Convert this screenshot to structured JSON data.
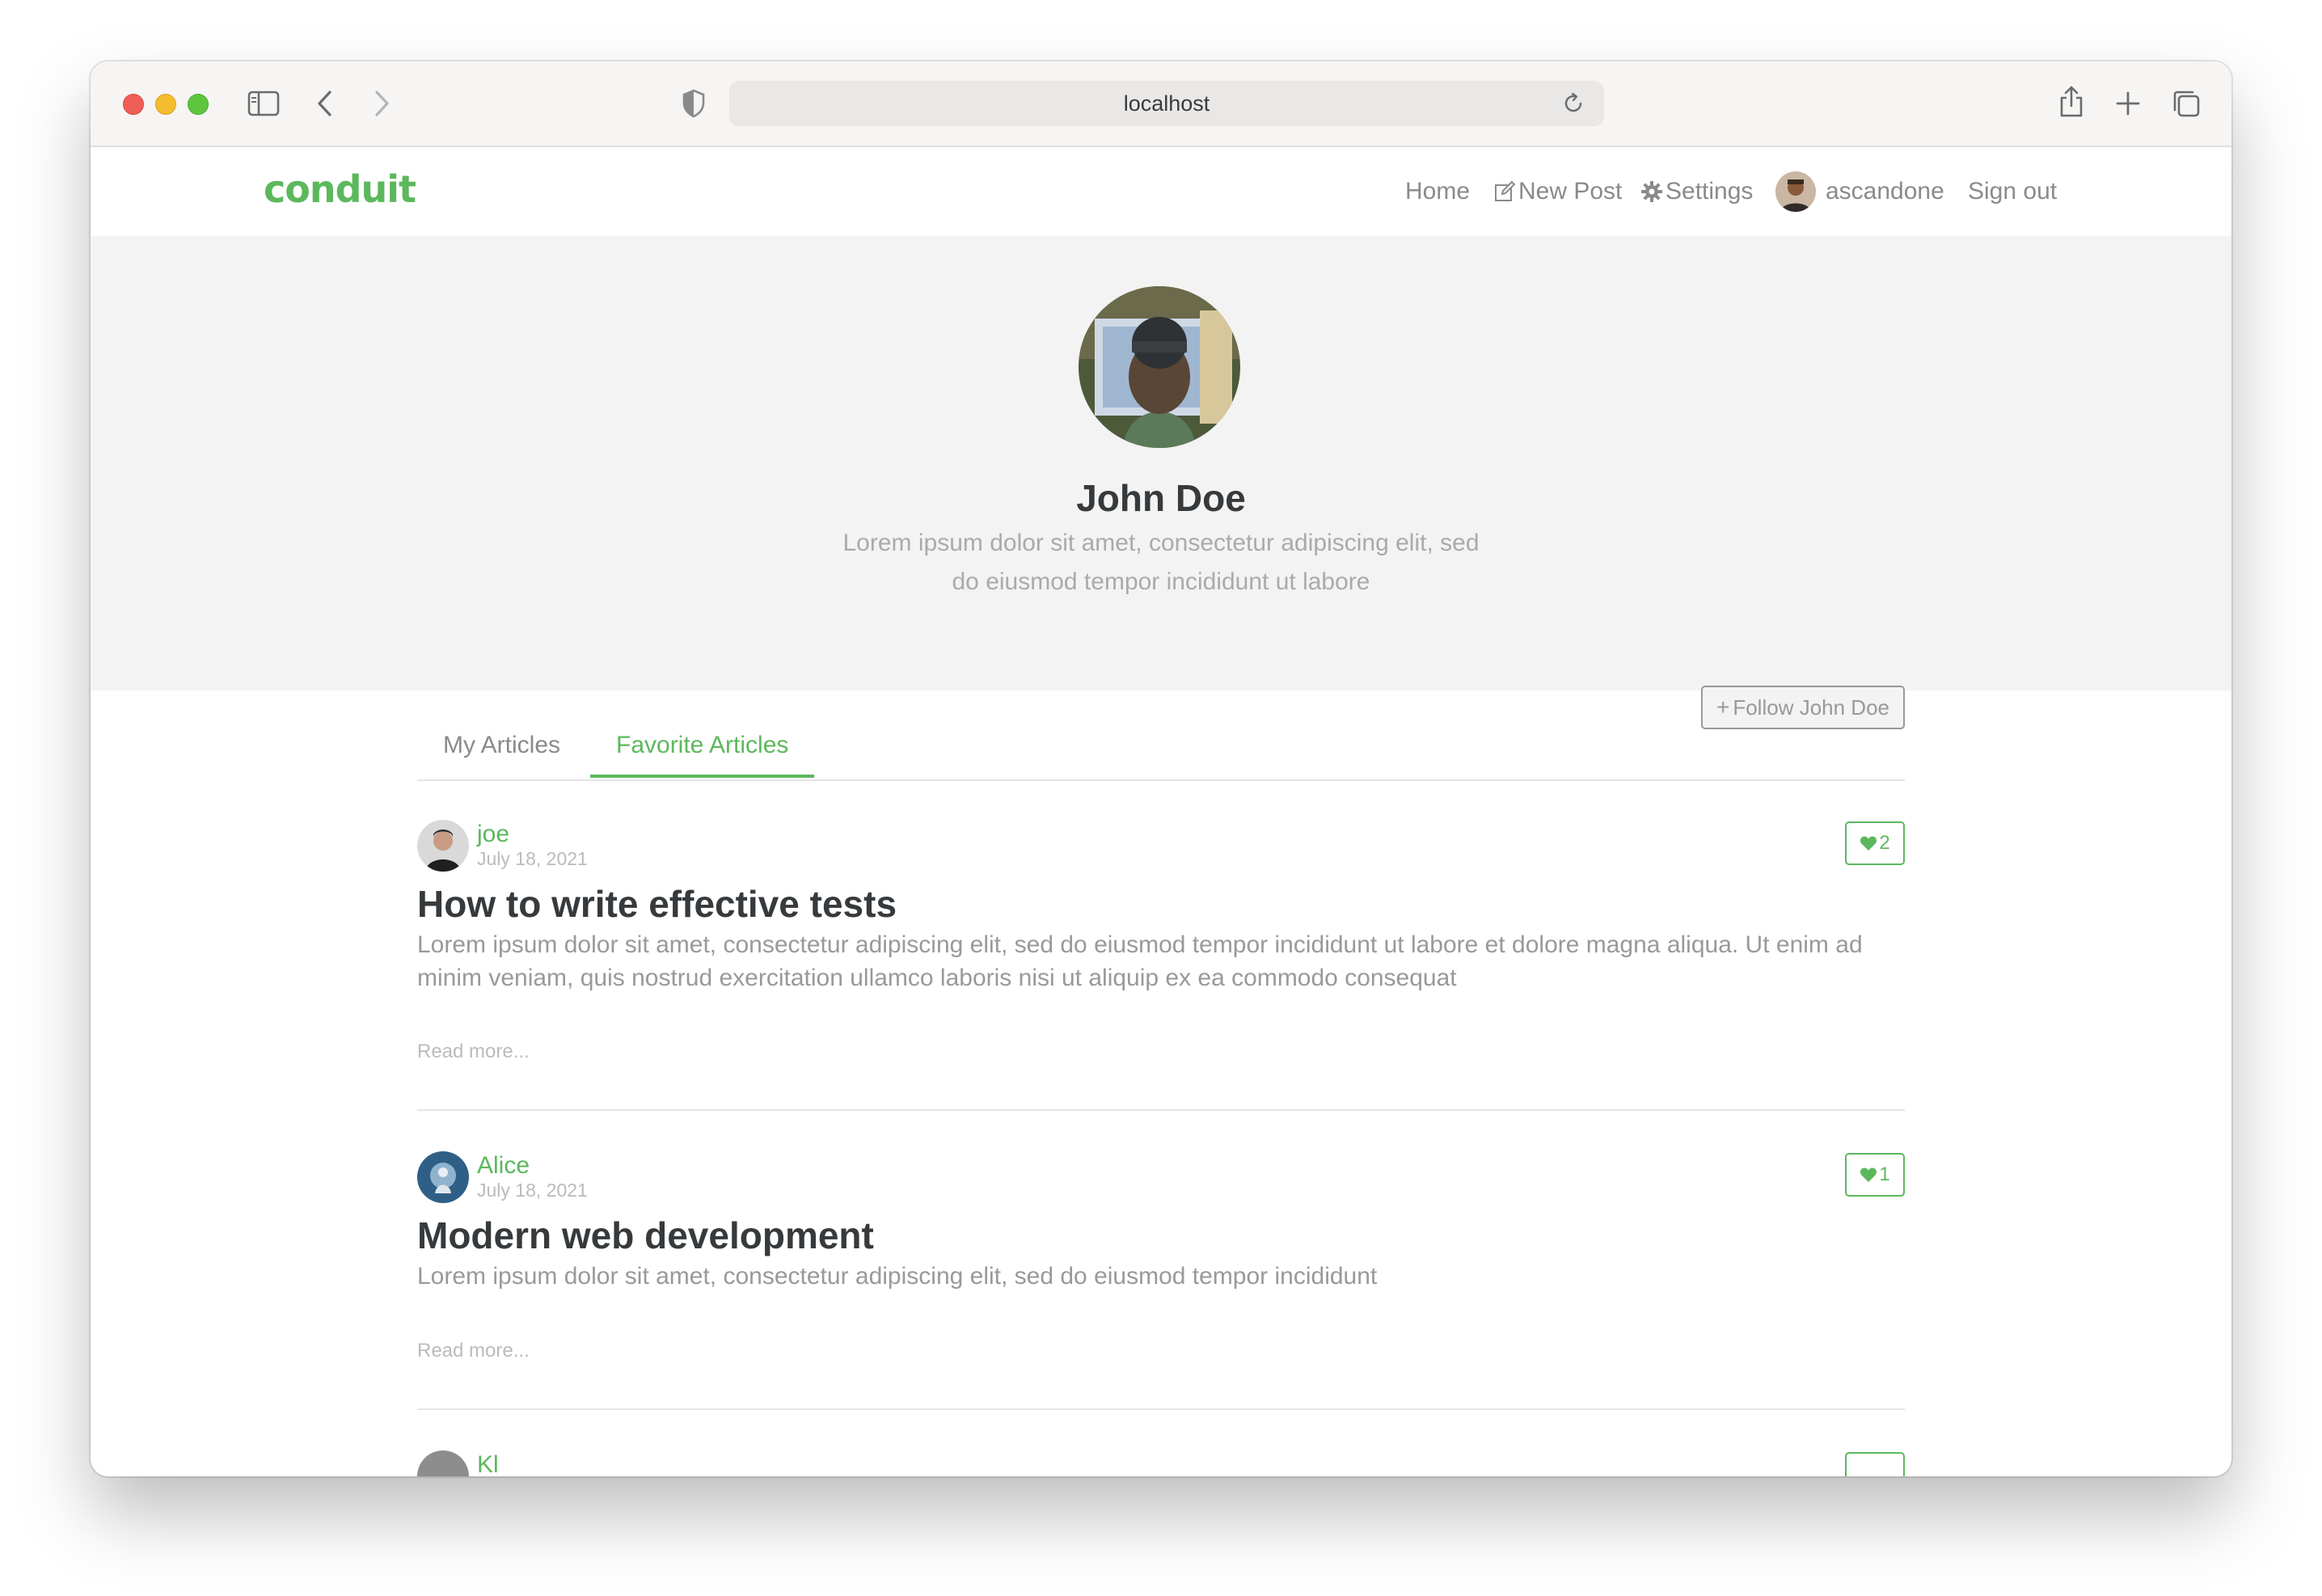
{
  "browser": {
    "url": "localhost",
    "icons": [
      "sidebar-icon",
      "back-icon",
      "forward-icon",
      "shield-icon",
      "reload-icon",
      "share-icon",
      "plus-icon",
      "tabs-icon"
    ]
  },
  "navbar": {
    "brand": "conduit",
    "items": {
      "home": "Home",
      "new_post": "New Post",
      "settings": "Settings",
      "username": "ascandone",
      "sign_out": "Sign out"
    }
  },
  "profile": {
    "name": "John Doe",
    "bio": "Lorem ipsum dolor sit amet, consectetur adipiscing elit, sed do eiusmod tempor incididunt ut labore",
    "follow_label": "Follow John Doe"
  },
  "tabs": {
    "my_articles": "My Articles",
    "favorite_articles": "Favorite Articles",
    "active": "Favorite Articles"
  },
  "articles": [
    {
      "author": "joe",
      "date": "July 18, 2021",
      "favorites": "2",
      "title": "How to write effective tests",
      "description": "Lorem ipsum dolor sit amet, consectetur adipiscing elit, sed do eiusmod tempor incididunt ut labore et dolore magna aliqua. Ut enim ad minim veniam, quis nostrud exercitation ullamco laboris nisi ut aliquip ex ea commodo consequat",
      "read_more": "Read more..."
    },
    {
      "author": "Alice",
      "date": "July 18, 2021",
      "favorites": "1",
      "title": "Modern web development",
      "description": "Lorem ipsum dolor sit amet, consectetur adipiscing elit, sed do eiusmod tempor incididunt",
      "read_more": "Read more..."
    },
    {
      "author": "Kl"
    }
  ],
  "colors": {
    "brand": "#5cb85c",
    "banner_bg": "#f3f3f3",
    "text_dark": "#373a3c",
    "text_muted": "#999999"
  }
}
